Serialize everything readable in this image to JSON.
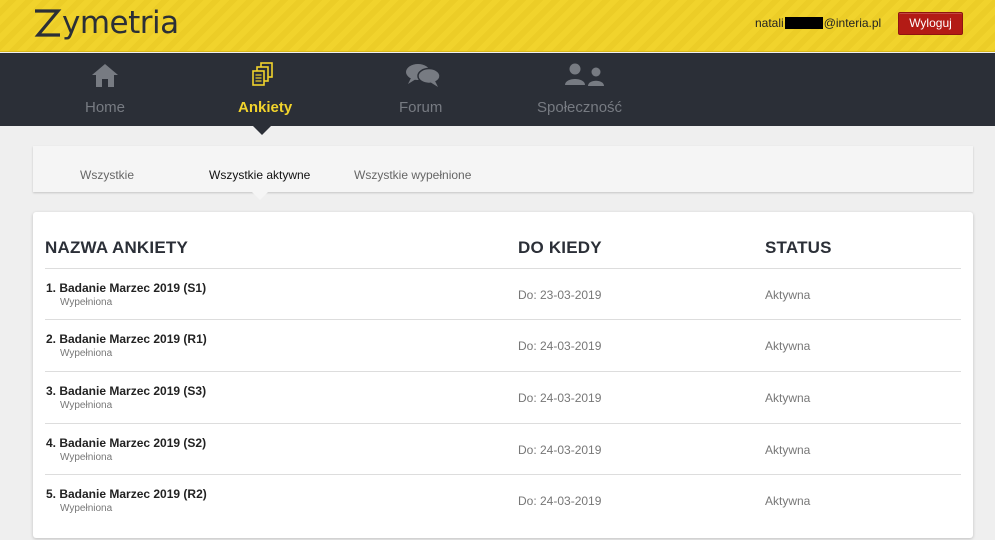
{
  "header": {
    "logo_text": "ymetria",
    "user_email_prefix": "natali",
    "user_email_suffix": "@interia.pl",
    "logout_label": "Wyloguj"
  },
  "nav": {
    "items": [
      {
        "label": "Home",
        "icon": "home-icon"
      },
      {
        "label": "Ankiety",
        "icon": "documents-icon",
        "active": true
      },
      {
        "label": "Forum",
        "icon": "chat-bubbles-icon"
      },
      {
        "label": "Społeczność",
        "icon": "users-icon"
      }
    ]
  },
  "filter_tabs": [
    {
      "label": "Wszystkie"
    },
    {
      "label": "Wszystkie aktywne",
      "active": true
    },
    {
      "label": "Wszystkie wypełnione"
    }
  ],
  "table": {
    "headers": {
      "name": "NAZWA ANKIETY",
      "deadline": "DO KIEDY",
      "status": "STATUS"
    },
    "rows": [
      {
        "title": "1.  Badanie Marzec 2019 (S1)",
        "sub": "Wypełniona",
        "date": "Do: 23-03-2019",
        "status": "Aktywna"
      },
      {
        "title": "2.  Badanie Marzec 2019 (R1)",
        "sub": "Wypełniona",
        "date": "Do: 24-03-2019",
        "status": "Aktywna"
      },
      {
        "title": "3.  Badanie Marzec 2019 (S3)",
        "sub": "Wypełniona",
        "date": "Do: 24-03-2019",
        "status": "Aktywna"
      },
      {
        "title": "4.  Badanie Marzec 2019 (S2)",
        "sub": "Wypełniona",
        "date": "Do: 24-03-2019",
        "status": "Aktywna"
      },
      {
        "title": "5.  Badanie Marzec 2019 (R2)",
        "sub": "Wypełniona",
        "date": "Do: 24-03-2019",
        "status": "Aktywna"
      }
    ]
  },
  "colors": {
    "brand_yellow": "#f1d32c",
    "nav_dark": "#2b2f37",
    "logout_red": "#b31b15"
  }
}
